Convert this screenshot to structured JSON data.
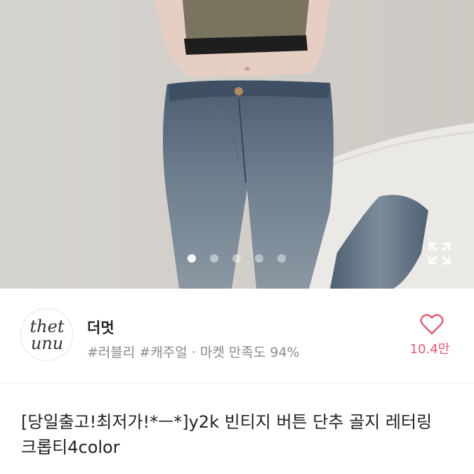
{
  "gallery": {
    "dot_count": 5,
    "active_index": 0,
    "expand_icon": "expand-icon"
  },
  "seller": {
    "logo_text": "thet\nunu",
    "name": "더멋",
    "tags": "#러블리 #캐주얼 · 마켓 만족도 94%",
    "like_count": "10.4만",
    "like_icon": "heart-outline-icon"
  },
  "product": {
    "title": "[당일출고!최저가!*ㅡ*]y2k 빈티지 버튼 단추 골지 레터링 크롭티4color"
  },
  "colors": {
    "accent": "#e85a6f",
    "secondary_text": "#8a8a8a"
  }
}
